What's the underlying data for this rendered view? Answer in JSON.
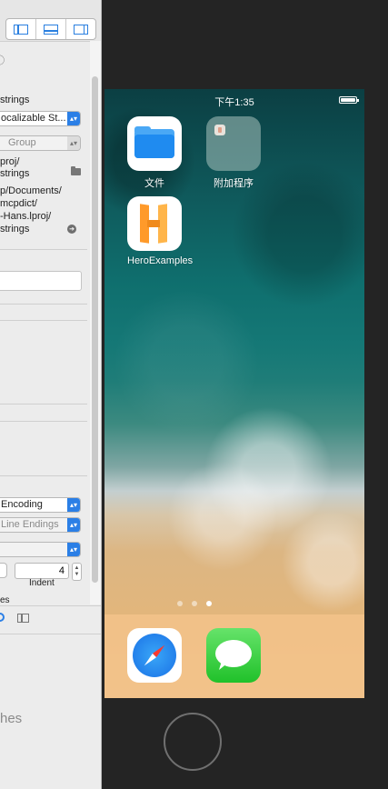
{
  "inspector": {
    "toolbar_layout_buttons": [
      "left-panel-icon",
      "bottom-panel-icon",
      "right-panel-icon"
    ],
    "partial_icon": "ⓘ",
    "file_name": "strings",
    "type_select": "ocalizable St...",
    "location_select": "Group",
    "path_line1": "proj/",
    "path_line2": "strings",
    "full_path_line1": "p/Documents/",
    "full_path_line2": "mcpdict/",
    "full_path_line3": "-Hans.lproj/",
    "full_path_line4": "strings",
    "encoding_select": "Encoding",
    "line_endings_select": "Line Endings",
    "indent_value": "4",
    "indent_label": "Indent",
    "partial_label": "es",
    "bottom_partial_text": "hes"
  },
  "simulator": {
    "status_time": "下午1:35",
    "apps": [
      {
        "label": "文件"
      },
      {
        "label": "附加程序"
      },
      {
        "label": "HeroExamples"
      }
    ],
    "page_dots": 3,
    "active_page": 3,
    "dock_apps": [
      "safari-icon",
      "messages-icon"
    ]
  }
}
